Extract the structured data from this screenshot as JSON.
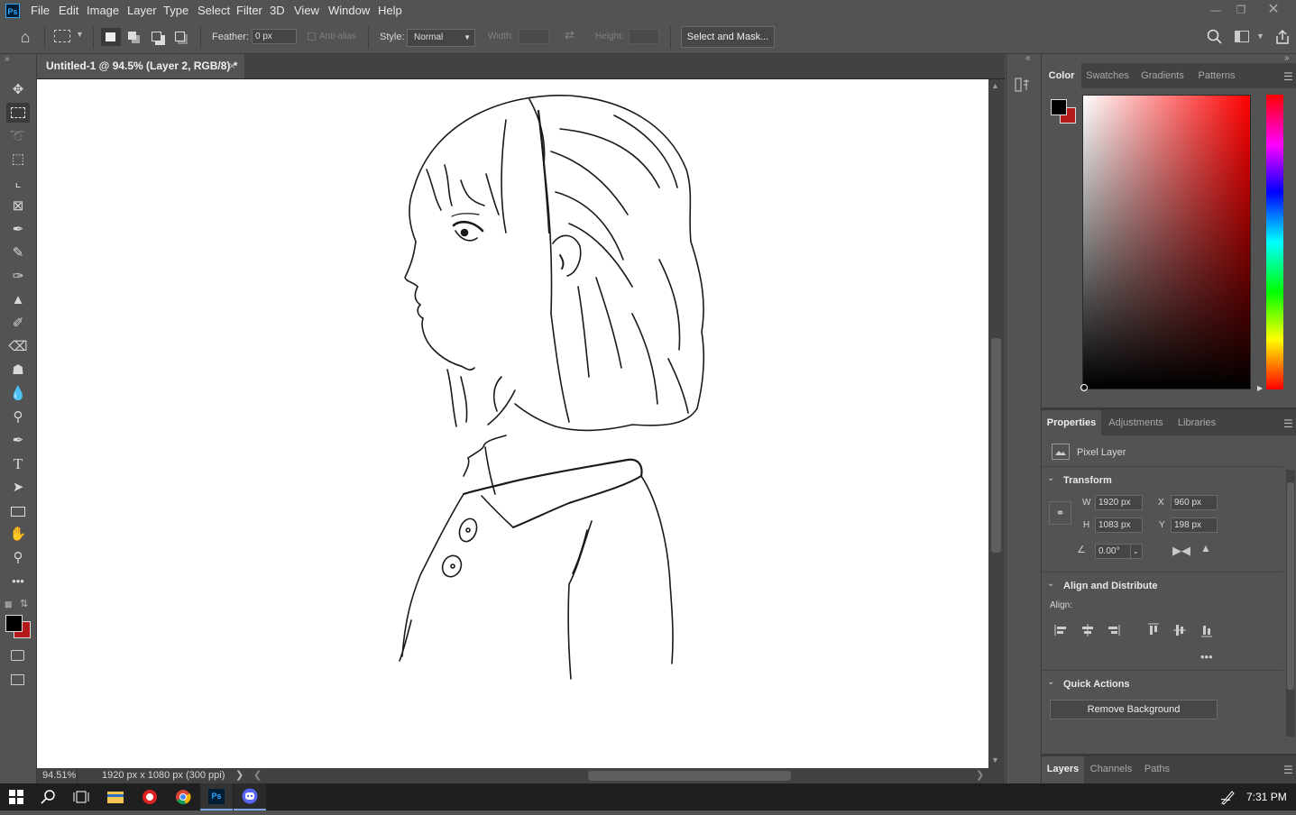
{
  "app": {
    "logo": "Ps"
  },
  "menu": [
    "File",
    "Edit",
    "Image",
    "Layer",
    "Type",
    "Select",
    "Filter",
    "3D",
    "View",
    "Window",
    "Help"
  ],
  "options": {
    "feather_label": "Feather:",
    "feather_value": "0 px",
    "antialias_label": "Anti-alias",
    "style_label": "Style:",
    "style_value": "Normal",
    "width_label": "Width:",
    "height_label": "Height:",
    "select_mask": "Select and Mask..."
  },
  "document": {
    "tab_title": "Untitled-1 @ 94.5% (Layer 2, RGB/8) *",
    "zoom": "94.51%",
    "doc_info": "1920 px x 1080 px (300 ppi)"
  },
  "color_panel": {
    "tabs": [
      "Color",
      "Swatches",
      "Gradients",
      "Patterns"
    ],
    "foreground": "#000000",
    "background": "#b51a1a",
    "hue_color": "#ff0000"
  },
  "properties_panel": {
    "tabs": [
      "Properties",
      "Adjustments",
      "Libraries"
    ],
    "layer_type": "Pixel Layer",
    "transform_title": "Transform",
    "w_label": "W",
    "w_value": "1920 px",
    "h_label": "H",
    "h_value": "1083 px",
    "x_label": "X",
    "x_value": "960 px",
    "y_label": "Y",
    "y_value": "198 px",
    "angle_value": "0.00°",
    "align_title": "Align and Distribute",
    "align_label": "Align:",
    "quick_title": "Quick Actions",
    "remove_bg": "Remove Background"
  },
  "layers_panel": {
    "tabs": [
      "Layers",
      "Channels",
      "Paths"
    ]
  },
  "taskbar": {
    "clock": "7:31 PM"
  },
  "toolbar_icons": [
    "move-tool-icon",
    "marquee-tool-icon",
    "lasso-tool-icon",
    "object-select-tool-icon",
    "crop-tool-icon",
    "frame-tool-icon",
    "eyedropper-tool-icon",
    "healing-brush-icon",
    "brush-tool-icon",
    "stamp-tool-icon",
    "history-brush-icon",
    "eraser-tool-icon",
    "paint-bucket-icon",
    "blur-tool-icon",
    "dodge-tool-icon",
    "pen-tool-icon",
    "type-tool-icon",
    "path-select-icon",
    "rectangle-tool-icon",
    "hand-tool-icon",
    "zoom-tool-icon",
    "more-tools-icon"
  ]
}
